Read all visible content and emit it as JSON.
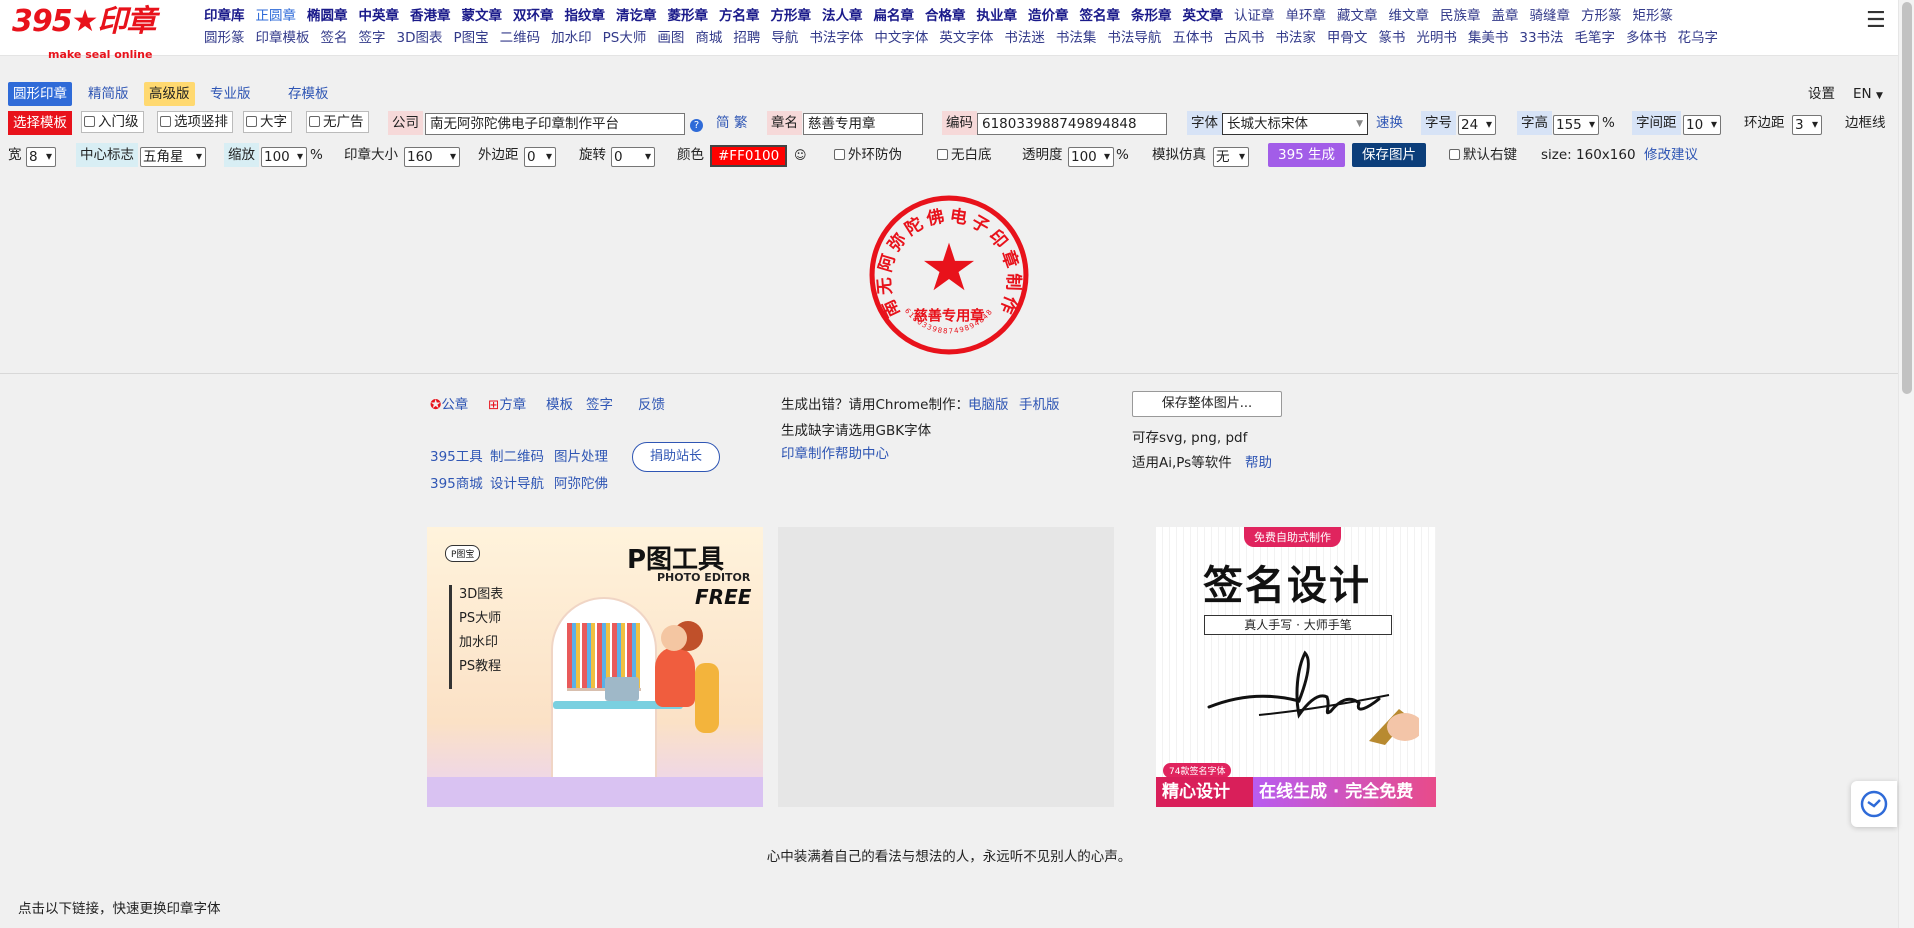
{
  "logo": {
    "main": "395★印章",
    "sub": "make seal online"
  },
  "nav_row1": [
    {
      "label": "印章库"
    },
    {
      "label": "正圆章",
      "active": true
    },
    {
      "label": "椭圆章"
    },
    {
      "label": "中英章"
    },
    {
      "label": "香港章"
    },
    {
      "label": "蒙文章"
    },
    {
      "label": "双环章"
    },
    {
      "label": "指纹章"
    },
    {
      "label": "清讫章"
    },
    {
      "label": "菱形章"
    },
    {
      "label": "方名章"
    },
    {
      "label": "方形章"
    },
    {
      "label": "法人章"
    },
    {
      "label": "扁名章"
    },
    {
      "label": "合格章"
    },
    {
      "label": "执业章"
    },
    {
      "label": "造价章"
    },
    {
      "label": "签名章"
    },
    {
      "label": "条形章"
    },
    {
      "label": "英文章"
    },
    {
      "label": "认证章",
      "thin": true
    },
    {
      "label": "单环章",
      "thin": true
    },
    {
      "label": "藏文章",
      "thin": true
    },
    {
      "label": "维文章",
      "thin": true
    },
    {
      "label": "民族章",
      "thin": true
    },
    {
      "label": "盖章",
      "thin": true
    },
    {
      "label": "骑缝章",
      "thin": true
    },
    {
      "label": "方形篆",
      "thin": true
    },
    {
      "label": "矩形篆",
      "thin": true
    }
  ],
  "nav_row2": [
    "圆形篆",
    "印章模板",
    "签名",
    "签字",
    "3D图表",
    "P图宝",
    "二维码",
    "加水印",
    "PS大师",
    "画图",
    "商城",
    "招聘",
    "导航",
    "书法字体",
    "中文字体",
    "英文字体",
    "书法迷",
    "书法集",
    "书法导航",
    "五体书",
    "古风书",
    "书法家",
    "甲骨文",
    "篆书",
    "光明书",
    "集美书",
    "33书法",
    "毛笔字",
    "多体书",
    "花乌字"
  ],
  "toolbar": {
    "tabs": [
      "圆形印章",
      "精简版",
      "高级版",
      "专业版"
    ],
    "save_template": "存模板",
    "settings": "设置",
    "lang": "EN",
    "choose_template": "选择模板",
    "checks": [
      "入门级",
      "选项竖排",
      "大字",
      "无广告"
    ],
    "company_label": "公司",
    "company_value": "南无阿弥陀佛电子印章制作平台",
    "simp": "简",
    "trad": "繁",
    "seal_name_label": "章名",
    "seal_name_value": "慈善专用章",
    "code_label": "编码",
    "code_value": "618033988749894848",
    "font_label": "字体",
    "font_value": "长城大标宋体",
    "quick_change": "速换",
    "font_size_label": "字号",
    "font_size_value": "24",
    "font_height_label": "字高",
    "font_height_value": "155",
    "percent": "%",
    "spacing_label": "字间距",
    "spacing_value": "10",
    "ring_margin_label": "环边距",
    "ring_margin_value": "3",
    "border_line_label": "边框线",
    "width_label": "宽",
    "width_value": "8",
    "center_label": "中心标志",
    "center_value": "五角星",
    "zoom_label": "缩放",
    "zoom_value": "100",
    "seal_size_label": "印章大小",
    "seal_size_value": "160",
    "outer_margin_label": "外边距",
    "outer_margin_value": "0",
    "rotate_label": "旋转",
    "rotate_value": "0",
    "color_label": "颜色",
    "color_value": "#FF0100",
    "outer_anti": "外环防伪",
    "no_white_bg": "无白底",
    "opacity_label": "透明度",
    "opacity_value": "100",
    "simulate_label": "模拟仿真",
    "simulate_value": "无",
    "generate": "395 生成",
    "save_image": "保存图片",
    "default_right": "默认右键",
    "size": "size: 160x160",
    "suggest": "修改建议"
  },
  "seal": {
    "ring_text": "南无阿弥陀佛电子印章制作平台",
    "name": "慈善专用章",
    "code": "618033988749894848",
    "color": "#e8121b"
  },
  "links": {
    "official": "公章",
    "square": "方章",
    "template": "模板",
    "sign": "签字",
    "feedback": "反馈",
    "tools": [
      "395工具",
      "制二维码",
      "图片处理"
    ],
    "donate": "捐助站长",
    "more": [
      "395商城",
      "设计导航",
      "阿弥陀佛"
    ],
    "error_prefix": "生成出错？请用Chrome制作：",
    "pc": "电脑版",
    "mobile": "手机版",
    "gbk_tip": "生成缺字请选用GBK字体",
    "help_center": "印章制作帮助中心",
    "save_all": "保存整体图片...",
    "formats": "可存svg, png, pdf",
    "software": "适用Ai,Ps等软件",
    "help": "帮助"
  },
  "ad1": {
    "badge": "P图宝",
    "title": "P图工具",
    "subtitle": "PHOTO EDITOR",
    "free": "FREE",
    "items": [
      "3D图表",
      "PS大师",
      "加水印",
      "PS教程"
    ]
  },
  "ad3": {
    "top_badge": "免费自助式制作",
    "title": "签名设计",
    "subtitle": "真人手写 · 大师手笔",
    "count_badge": "74款签名字体",
    "left": "精心设计",
    "right": "在线生成 · 完全免费"
  },
  "quote": "心中装满着自己的看法与想法的人，永远听不见别人的心声。",
  "bottom_note": "点击以下链接，快速更换印章字体"
}
